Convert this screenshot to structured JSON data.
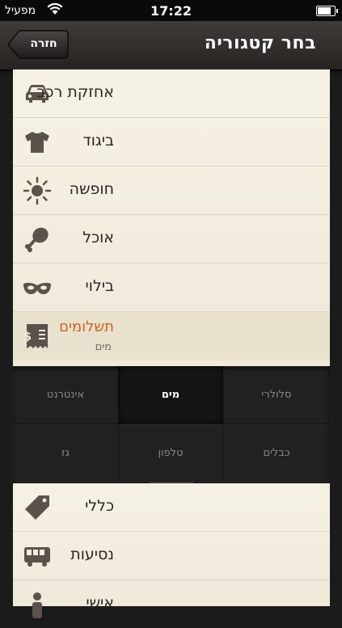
{
  "status_bar": {
    "carrier": "מפעיל",
    "time": "17:22",
    "battery_level": 0.9
  },
  "navbar": {
    "title": "בחר קטגוריה",
    "back_label": "חזרה"
  },
  "categories": [
    {
      "label": "אחזקת רכב",
      "icon": "car-icon"
    },
    {
      "label": "ביגוד",
      "icon": "tshirt-icon"
    },
    {
      "label": "חופשה",
      "icon": "sun-icon"
    },
    {
      "label": "אוכל",
      "icon": "drumstick-icon"
    },
    {
      "label": "בילוי",
      "icon": "mask-icon"
    },
    {
      "label": "תשלומים",
      "sublabel": "מים",
      "icon": "bill-icon",
      "selected": true
    }
  ],
  "subcategories": [
    {
      "label": "אינטרנט"
    },
    {
      "label": "מים",
      "active": true
    },
    {
      "label": "סלולרי"
    },
    {
      "label": "גז"
    },
    {
      "label": "טלפון"
    },
    {
      "label": "כבלים"
    }
  ],
  "pager": {
    "pages": 3,
    "current": 1
  },
  "categories_more": [
    {
      "label": "כללי",
      "icon": "tag-icon"
    },
    {
      "label": "נסיעות",
      "icon": "bus-icon"
    },
    {
      "label": "אישי",
      "icon": "person-icon"
    }
  ],
  "colors": {
    "accent": "#d0631e",
    "list_bg": "#f3eee0",
    "icon": "#5a524b"
  }
}
